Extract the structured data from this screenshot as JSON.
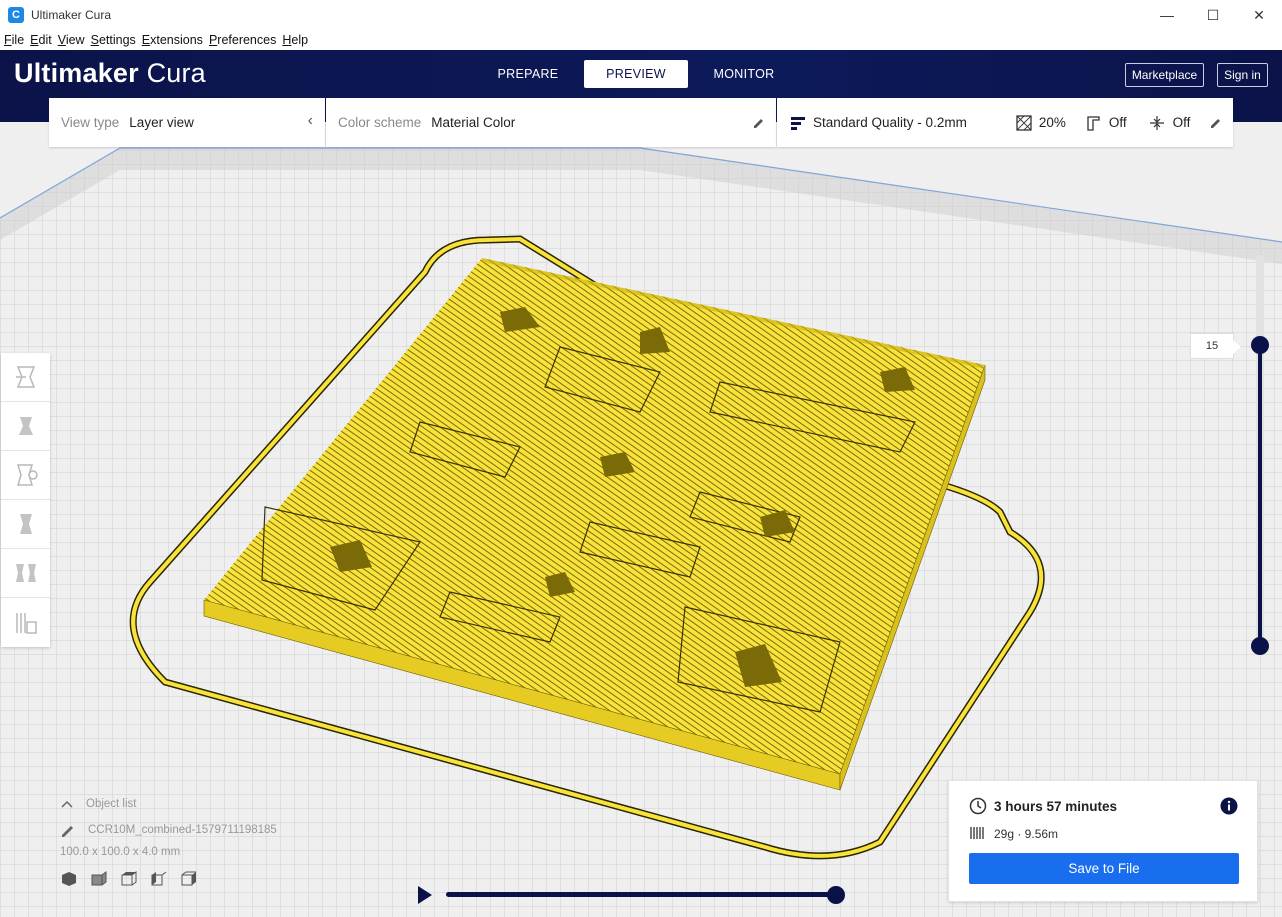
{
  "window": {
    "title": "Ultimaker Cura",
    "min": "—",
    "max": "☐",
    "close": "✕"
  },
  "menu": [
    "File",
    "Edit",
    "View",
    "Settings",
    "Extensions",
    "Preferences",
    "Help"
  ],
  "header": {
    "logo_bold": "Ultimaker",
    "logo_light": "Cura",
    "stages": [
      "PREPARE",
      "PREVIEW",
      "MONITOR"
    ],
    "active_stage": "PREVIEW",
    "marketplace": "Marketplace",
    "signin": "Sign in"
  },
  "view_panel": {
    "label": "View type",
    "value": "Layer view"
  },
  "color_panel": {
    "label": "Color scheme",
    "value": "Material Color"
  },
  "print_settings": {
    "profile": "Standard Quality - 0.2mm",
    "infill": "20%",
    "support": "Off",
    "adhesion": "Off"
  },
  "tools": [
    "move-tool",
    "scale-tool",
    "rotate-tool",
    "mirror-tool",
    "per-model-settings-tool",
    "support-blocker-tool"
  ],
  "layer_slider": {
    "current_layer": "15",
    "min_layer": 0
  },
  "object_list": {
    "header": "Object list",
    "file": "CCR10M_combined-1579711198185",
    "dimensions": "100.0 x 100.0 x 4.0 mm"
  },
  "simulation": {
    "progress": 1.0
  },
  "print_info": {
    "time": "3 hours 57 minutes",
    "material": "29g · 9.56m",
    "save_label": "Save to File"
  },
  "colors": {
    "header": "#0a1248",
    "accent": "#196ef0",
    "model": "#f9e33b",
    "bed_grid": "#d6d6d6"
  }
}
